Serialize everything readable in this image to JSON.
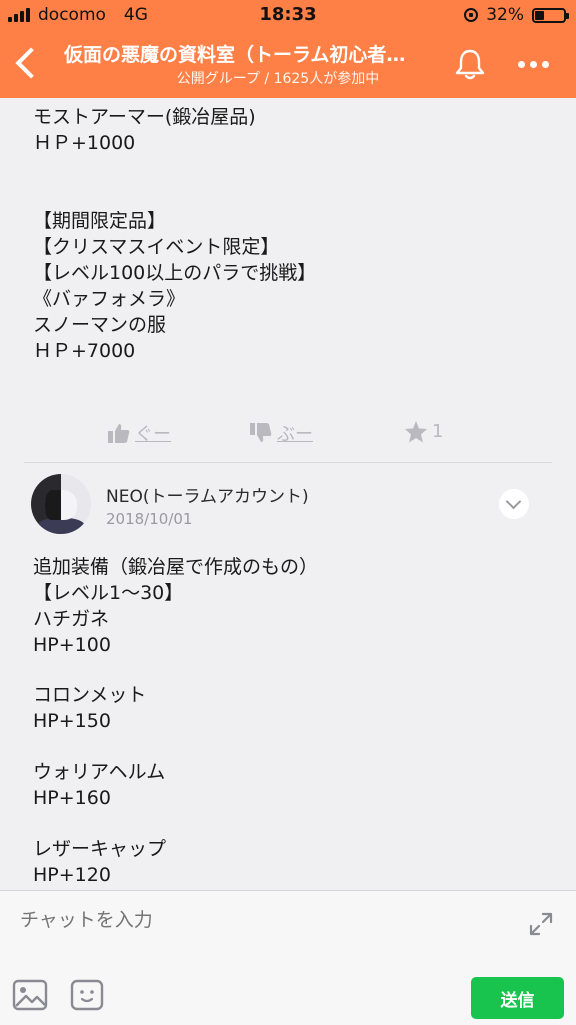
{
  "status_bar": {
    "carrier": "docomo",
    "network": "4G",
    "time": "18:33",
    "battery": "32%"
  },
  "header": {
    "title": "仮面の悪魔の資料室（トーラム初心者…",
    "subtitle": "公開グループ / 1625人が参加中",
    "accent_color": "#ff8046",
    "icons": [
      "back-arrow-icon",
      "bell-icon",
      "more-icon"
    ]
  },
  "post1": {
    "lines_a": "モストアーマー(鍛冶屋品)\nＨＰ+1000",
    "lines_b": "【期間限定品】\n【クリスマスイベント限定】\n【レベル100以上のパラで挑戦】\n《バァフォメラ》\nスノーマンの服\nＨＰ+7000",
    "reactions": {
      "good_label": "ぐー",
      "bad_label": "ぶー",
      "star_count": "1"
    }
  },
  "post2": {
    "author": "NEO(トーラムアカウント)",
    "date": "2018/10/01",
    "lines_a": "追加装備（鍛冶屋で作成のもの）\n【レベル1〜30】\nハチガネ\nHP+100",
    "lines_b": "コロンメット\nHP+150",
    "lines_c": "ウォリアヘルム\nHP+160",
    "lines_d": "レザーキャップ\nHP+120"
  },
  "footer": {
    "input_placeholder": "チャットを入力",
    "send_label": "送信",
    "send_color": "#19c44e"
  }
}
